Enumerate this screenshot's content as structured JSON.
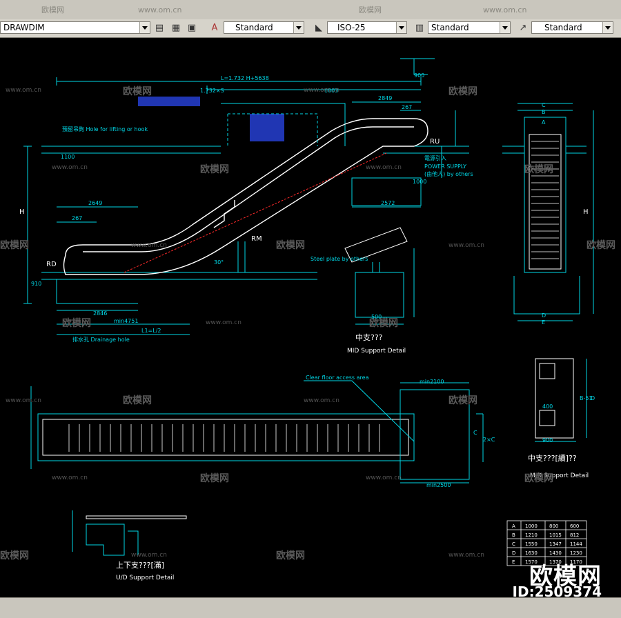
{
  "toolbar": {
    "layer_combo": "DRAWDIM",
    "text_style": "Standard",
    "dim_style": "ISO-25",
    "table_style": "Standard",
    "multileader_style": "Standard"
  },
  "watermarks": {
    "brand": "欧模网",
    "site": "www.om.cn"
  },
  "brand_overlay": {
    "name": "欧模网",
    "id": "ID:2509374"
  },
  "drawing": {
    "dim_top": "L=1.732 H+5638",
    "dim_1732": "1.732×S",
    "dim_6003": "6003",
    "dim_2849": "2849",
    "dim_267_top": "267",
    "dim_900": "900",
    "dim_2649": "2649",
    "dim_267": "267",
    "dim_2846": "2846",
    "dim_min4751": "min4751",
    "dim_l2": "L1=L/2",
    "dim_2572": "2572",
    "dim_910": "910",
    "dim_1100": "1100",
    "dim_1000": "1000",
    "label_ru": "RU",
    "label_rm": "RM",
    "label_rd": "RD",
    "label_h": "H",
    "angle": "30°",
    "power_supply_cn": "電源引入",
    "power_supply": "POWER SUPPLY",
    "power_supply_by": "(由他人) by others",
    "hole_lifting": "預留吊鉤 Hole for lifting or hook",
    "drainage": "排水孔 Drainage hole",
    "mid_support_cn": "中支???",
    "mid_support": "MID Support Detail",
    "ud_support_cn": "上下支???[滿]",
    "ud_support": "U/D Support Detail",
    "mid_support2_cn": "中支???[續]??",
    "mid_support2": "MID Support Detail",
    "steel_plate": "Steel plate by others",
    "min2100": "min2100",
    "min2500": "min2500",
    "dim_500": "500",
    "dim_400": "400",
    "dim_900b": "900",
    "dim_ab": "A",
    "dim_bb": "B",
    "dim_cb": "C",
    "dim_d": "D",
    "dim_e": "E",
    "dim_2xc": "2×C",
    "dim_b11": "B-51",
    "clear_floor": "Clear floor access area"
  },
  "size_table": {
    "rows": [
      [
        "A",
        "1000",
        "800",
        "600"
      ],
      [
        "B",
        "1210",
        "1015",
        "812"
      ],
      [
        "C",
        "1550",
        "1347",
        "1144"
      ],
      [
        "D",
        "1630",
        "1430",
        "1230"
      ],
      [
        "E",
        "1570",
        "1370",
        "1170"
      ]
    ]
  },
  "colors": {
    "cyan": "#00d7e6",
    "white": "#ffffff",
    "blue": "#2e4dff",
    "red": "#ff2a2a",
    "toolbar": "#d6d3ca"
  }
}
